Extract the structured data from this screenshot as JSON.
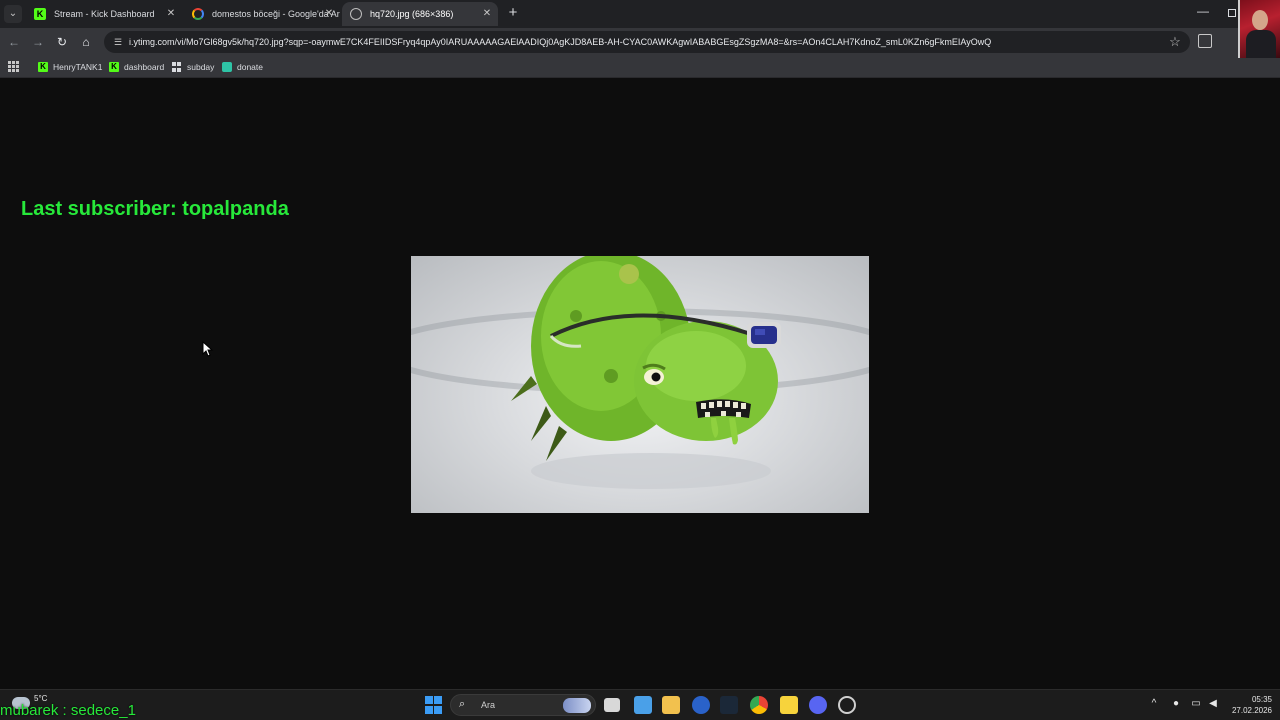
{
  "browser": {
    "tabs": [
      {
        "title": "Stream - Kick Dashboard",
        "favicon": "kick-icon",
        "active": false
      },
      {
        "title": "domestos böceği - Google'da Ar",
        "favicon": "google-icon",
        "active": false
      },
      {
        "title": "hq720.jpg (686×386)",
        "favicon": "globe-icon",
        "active": true
      }
    ],
    "url": "i.ytimg.com/vi/Mo7Gl68gv5k/hq720.jpg?sqp=-oaymwE7CK4FEIIDSFryq4qpAy0IARUAAAAAGAElAADIQj0AgKJD8AEB-AH-CYAC0AWKAgwIABABGEsgZSgzMA8=&rs=AOn4CLAH7KdnoZ_smL0KZn6gFkmEIAyOwQ",
    "bookmarks": [
      {
        "label": "HenryTANK1",
        "icon": "kick-icon"
      },
      {
        "label": "dashboard",
        "icon": "kick-icon"
      },
      {
        "label": "subday",
        "icon": "grid-icon"
      },
      {
        "label": "donate",
        "icon": "donate-icon"
      }
    ]
  },
  "page": {
    "last_subscriber": "Last subscriber: topalpanda",
    "image_alt_subject": "green cartoon germ character with blue eyepatch"
  },
  "overlay": {
    "chat_line": "mubarek : sedece_1"
  },
  "taskbar": {
    "weather_temp": "5°C",
    "search_placeholder": "Ara",
    "time": "05:35",
    "date": "27.02.2026"
  },
  "colors": {
    "accent_green": "#27e83a",
    "kick_green": "#53fc18",
    "page_bg": "#0d0d0d"
  }
}
